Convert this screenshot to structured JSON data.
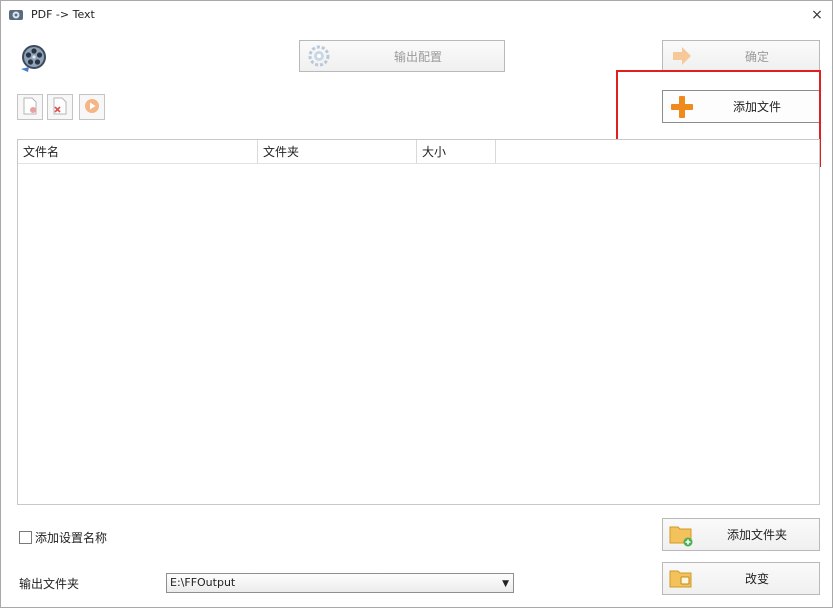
{
  "window": {
    "title": "PDF -> Text",
    "close_symbol": "×"
  },
  "toolbar": {
    "output_config_label": "输出配置",
    "confirm_label": "确定",
    "add_file_label": "添加文件"
  },
  "filelist": {
    "columns": [
      "文件名",
      "文件夹",
      "大小"
    ]
  },
  "bottom": {
    "add_setting_name_label": "添加设置名称",
    "output_folder_label": "输出文件夹",
    "output_folder_value": "E:\\FFOutput",
    "add_folder_label": "添加文件夹",
    "change_label": "改变"
  },
  "colors": {
    "highlight": "#e02020",
    "accent_orange": "#f08a1c"
  },
  "icons": [
    "app-icon",
    "film-reel-icon",
    "gear-icon",
    "arrow-right-icon",
    "plus-icon",
    "add-doc-icon",
    "remove-doc-icon",
    "play-icon",
    "folder-add-icon",
    "folder-change-icon",
    "close-icon",
    "dropdown-arrow-icon"
  ]
}
